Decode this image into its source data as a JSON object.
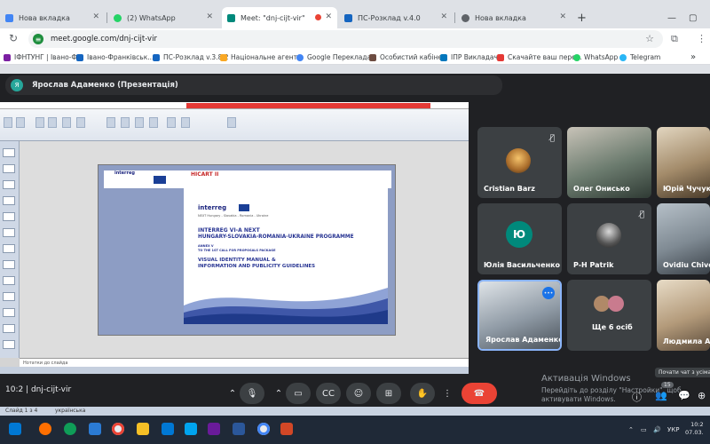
{
  "browser": {
    "tabs": [
      {
        "label": "Нова вкладка",
        "active": false,
        "icon_color": "#4285f4"
      },
      {
        "label": "(2) WhatsApp",
        "active": false,
        "icon_color": "#25d366"
      },
      {
        "label": "Meet: \"dnj-cijt-vir\"",
        "active": true,
        "icon_color": "#00897b"
      },
      {
        "label": "ПС-Розклад v.4.0",
        "active": false,
        "icon_color": "#1565c0"
      },
      {
        "label": "Нова вкладка",
        "active": false,
        "icon_color": "#5f6368"
      }
    ],
    "url": "meet.google.com/dnj-cijt-vir",
    "bookmarks": [
      {
        "label": "ІФНТУНГ | Івано-Ф...",
        "color": "#7b1fa2"
      },
      {
        "label": "Івано-Франківськ...",
        "color": "#1565c0"
      },
      {
        "label": "ПС-Розклад v.3.8.2",
        "color": "#1565c0"
      },
      {
        "label": "Національне агент...",
        "color": "#f9a825"
      },
      {
        "label": "Google Перекладач",
        "color": "#4285f4"
      },
      {
        "label": "Особистий кабінет",
        "color": "#6d4c41"
      },
      {
        "label": "ІПР Викладача",
        "color": "#0277bd"
      },
      {
        "label": "Скачайте ваш пере...",
        "color": "#e53935"
      },
      {
        "label": "WhatsApp",
        "color": "#25d366"
      },
      {
        "label": "Telegram",
        "color": "#29b6f6"
      }
    ]
  },
  "meet": {
    "presenter_initial": "Я",
    "presenter_label": "Ярослав Адаменко (Презентація)",
    "slide": {
      "header_tag": "HICART II",
      "logo_small": "interreg",
      "logo_main": "interreg",
      "logo_sub": "NEXT Hungary - Slovakia - Romania - Ukraine",
      "line1": "INTERREG VI-A NEXT",
      "line2": "HUNGARY-SLOVAKIA-ROMANIA-UKRAINE PROGRAMME",
      "annex": "ANNEX V",
      "annex_sub": "TO THE 1ST CALL FOR PROPOSALS PACKAGE",
      "title1": "VISUAL IDENTITY MANUAL &",
      "title2": "INFORMATION AND PUBLICITY GUIDELINES",
      "notes_placeholder": "Нотатки до слайда"
    },
    "participants": [
      {
        "name": "Cristian Barz",
        "muted": true,
        "type": "avatar-image",
        "color": "#e6a23c"
      },
      {
        "name": "Олег Онисько",
        "muted": false,
        "type": "video",
        "color": "#6b7b6e"
      },
      {
        "name": "Юрій Чучук",
        "muted": false,
        "type": "video",
        "color": "#a38b6a"
      },
      {
        "name": "Юлія Васильченко",
        "muted": false,
        "type": "initial",
        "initial": "Ю",
        "color": "#00897b"
      },
      {
        "name": "P-H Patrik",
        "muted": true,
        "type": "avatar-image",
        "color": "#555"
      },
      {
        "name": "Ovidiu Chiver",
        "muted": false,
        "type": "video",
        "color": "#7f8a93"
      },
      {
        "name": "Ярослав Адаменко",
        "muted": false,
        "type": "video",
        "color": "#8f9aa5",
        "speaking": true
      },
      {
        "name": "Ще 6 осіб",
        "muted": false,
        "type": "more"
      },
      {
        "name": "Людмила Арх",
        "muted": false,
        "type": "video",
        "color": "#b39a7a"
      }
    ],
    "meeting_code": "dnj-cijt-vir",
    "chat_tooltip": "Почати чат з усіма",
    "participant_count": "15",
    "activation_title": "Активація Windows",
    "activation_text": "Перейдіть до розділу \"Настройки\", щоб активувати Windows."
  },
  "os": {
    "status_left": "Слайд 1 з 4",
    "language": "українська",
    "keyboard": "УКР",
    "time": "10:2",
    "date": "07.03."
  }
}
